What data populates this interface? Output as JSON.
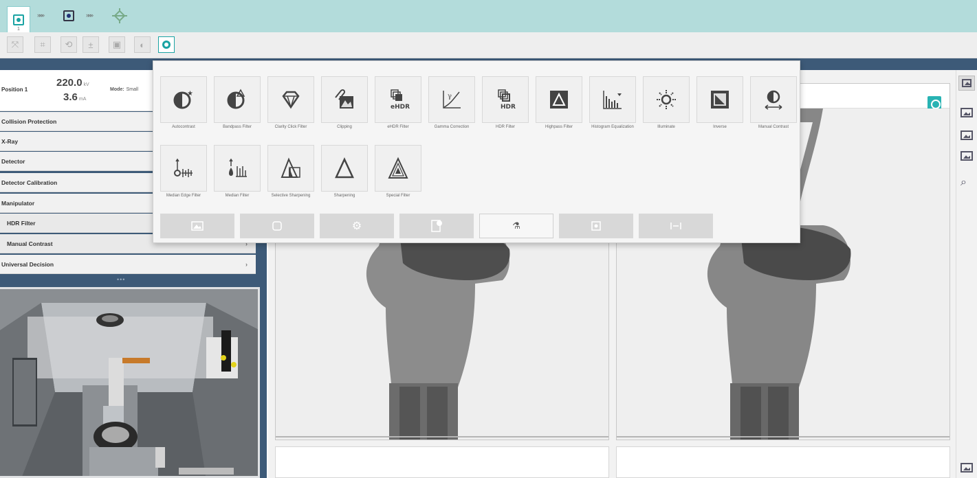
{
  "workflow": {
    "steps": [
      {
        "name": "acquisition",
        "number": "1"
      },
      {
        "name": "reconstruction"
      },
      {
        "name": "positioning"
      }
    ],
    "arrow_text": "»»»"
  },
  "status": {
    "position_label": "Position 1",
    "voltage_value": "220.0",
    "voltage_unit": "kV",
    "current_value": "3.6",
    "current_unit": "mA",
    "mode_label": "Mode:",
    "mode_value": "Small"
  },
  "accordion": {
    "collision": "Collision Protection",
    "xray": "X-Ray",
    "detector": "Detector",
    "calibration": "Detector Calibration",
    "manipulator": "Manipulator",
    "hdr_filter": "HDR Filter",
    "manual_contrast": "Manual Contrast",
    "universal_decision": "Universal Decision",
    "chevron": "›"
  },
  "filters_row1": [
    {
      "label": "Autocontrast"
    },
    {
      "label": "Bandpass Filter"
    },
    {
      "label": "Clarity Click Filter"
    },
    {
      "label": "Clipping"
    },
    {
      "label": "eHDR Filter",
      "icon_text": "eHDR"
    },
    {
      "label": "Gamma Correction"
    },
    {
      "label": "HDR Filter",
      "icon_text": "HDR"
    },
    {
      "label": "Highpass Filter"
    },
    {
      "label": "Histogram Equalization"
    },
    {
      "label": "Illuminate"
    },
    {
      "label": "Inverse"
    },
    {
      "label": "Manual Contrast"
    }
  ],
  "filters_row2": [
    {
      "label": "Median Edge Filter"
    },
    {
      "label": "Median Filter"
    },
    {
      "label": "Selective Sharpening"
    },
    {
      "label": "Sharpening"
    },
    {
      "label": "Special Filter"
    }
  ],
  "colors": {
    "accent": "#1aa3a3",
    "topbar": "#b3dcdb",
    "panel_dark": "#3d5a78"
  },
  "icons": {
    "gear": "⚙",
    "filters": "⚗"
  }
}
